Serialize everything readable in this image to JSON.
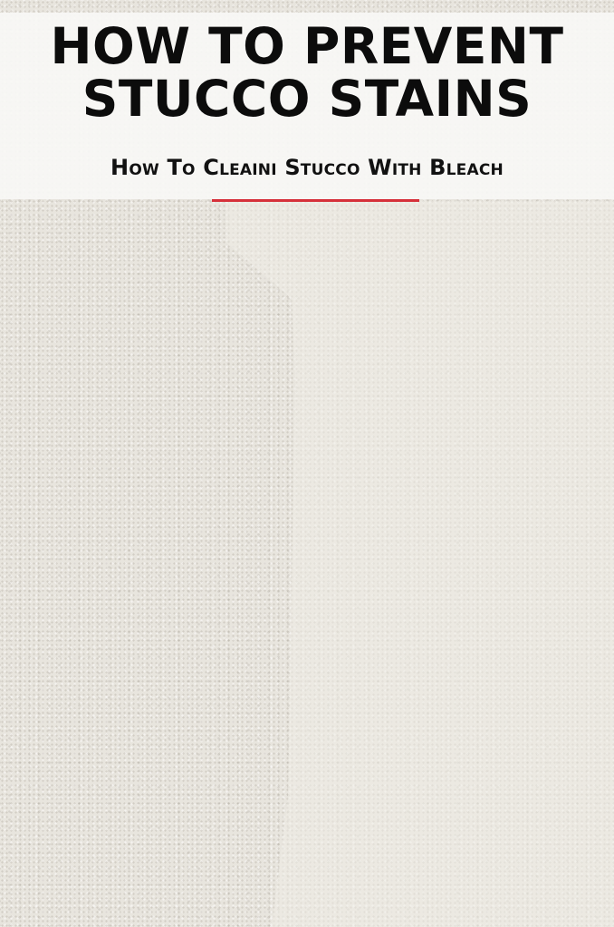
{
  "header": {
    "title_line_1": "HOW TO PREVENT",
    "title_line_2": "STUCCO STAINS",
    "subtitle": "How To Cleaini Stucco With Bleach"
  },
  "colors": {
    "accent_rule": "#d6303a",
    "header_band": "#f8f7f5",
    "stucco_wall": "#e8e5de",
    "title_text": "#0c0c0c"
  }
}
